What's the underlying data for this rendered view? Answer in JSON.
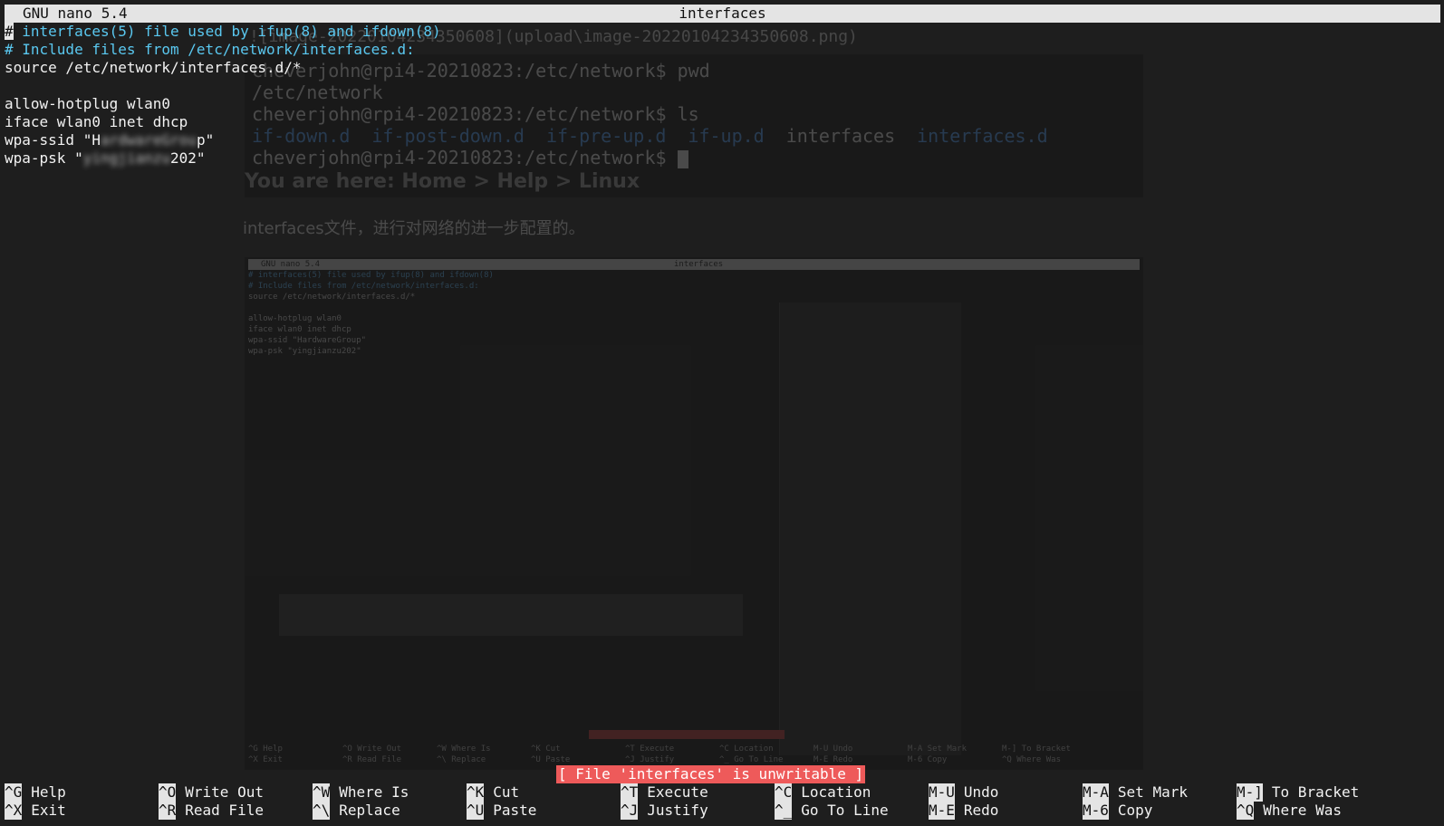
{
  "titlebar": {
    "app_version": "GNU nano 5.4",
    "file_name": "interfaces"
  },
  "editor": {
    "lines": [
      {
        "text": "# interfaces(5) file used by ifup(8) and ifdown(8)",
        "kind": "comment"
      },
      {
        "text": "# Include files from /etc/network/interfaces.d:",
        "kind": "comment"
      },
      {
        "text": "source /etc/network/interfaces.d/*",
        "kind": "normal"
      },
      {
        "text": "",
        "kind": "normal"
      },
      {
        "text": "allow-hotplug wlan0",
        "kind": "normal"
      },
      {
        "text": "iface wlan0 inet dhcp",
        "kind": "normal"
      },
      {
        "ssid_prefix": "wpa-ssid \"H",
        "ssid_hidden": "ardwareGrou",
        "ssid_suffix": "p\"",
        "kind": "redacted"
      },
      {
        "psk_prefix": "wpa-psk \"",
        "psk_hidden": "yingjianzu",
        "psk_suffix": "202\"",
        "kind": "redacted"
      }
    ]
  },
  "status_message": "[ File 'interfaces' is unwritable ]",
  "shortcuts": [
    {
      "key": "^G",
      "label": "Help"
    },
    {
      "key": "^X",
      "label": "Exit"
    },
    {
      "key": "^O",
      "label": "Write Out"
    },
    {
      "key": "^R",
      "label": "Read File"
    },
    {
      "key": "^W",
      "label": "Where Is"
    },
    {
      "key": "^\\",
      "label": "Replace"
    },
    {
      "key": "^K",
      "label": "Cut"
    },
    {
      "key": "^U",
      "label": "Paste"
    },
    {
      "key": "^T",
      "label": "Execute"
    },
    {
      "key": "^J",
      "label": "Justify"
    },
    {
      "key": "^C",
      "label": "Location"
    },
    {
      "key": "^_",
      "label": "Go To Line"
    },
    {
      "key": "M-U",
      "label": "Undo"
    },
    {
      "key": "M-E",
      "label": "Redo"
    },
    {
      "key": "M-A",
      "label": "Set Mark"
    },
    {
      "key": "M-6",
      "label": "Copy"
    },
    {
      "key": "M-]",
      "label": "To Bracket"
    },
    {
      "key": "^Q",
      "label": "Where Was"
    }
  ],
  "background_page": {
    "image_link": "![image-20220104234350608](upload\\image-20220104234350608.png)",
    "terminal_lines": [
      "cheverjohn@rpi4-20210823:/etc/network$ pwd",
      "/etc/network",
      "cheverjohn@rpi4-20210823:/etc/network$ ls"
    ],
    "ls_entries": [
      {
        "name": "if-down.d",
        "type": "dir"
      },
      {
        "name": "if-post-down.d",
        "type": "dir"
      },
      {
        "name": "if-pre-up.d",
        "type": "dir"
      },
      {
        "name": "if-up.d",
        "type": "dir"
      },
      {
        "name": "interfaces",
        "type": "file"
      },
      {
        "name": "interfaces.d",
        "type": "dir"
      }
    ],
    "last_prompt": "cheverjohn@rpi4-20210823:/etc/network$ ",
    "breadcrumb": "You are here: Home > Help > Linux",
    "paragraph": "interfaces文件，进行对网络的进一步配置的。",
    "embedded_shot": {
      "title_left": "GNU nano 5.4",
      "title_center": "interfaces",
      "lines": [
        "# interfaces(5) file used by ifup(8) and ifdown(8)",
        "# Include files from /etc/network/interfaces.d:",
        "source /etc/network/interfaces.d/*",
        "",
        "allow-hotplug wlan0",
        "iface wlan0 inet dhcp",
        "wpa-ssid \"HardwareGroup\"",
        "wpa-psk \"yingjianzu202\""
      ],
      "shortcut_row1": [
        "^G Help",
        "^O Write Out",
        "^W Where Is",
        "^K Cut",
        "^T Execute",
        "^C Location",
        "M-U Undo",
        "M-A Set Mark",
        "M-] To Bracket"
      ],
      "shortcut_row2": [
        "^X Exit",
        "^R Read File",
        "^\\ Replace",
        "^U Paste",
        "^J Justify",
        "^_ Go To Line",
        "M-E Redo",
        "M-6 Copy",
        "^Q Where Was"
      ]
    }
  }
}
